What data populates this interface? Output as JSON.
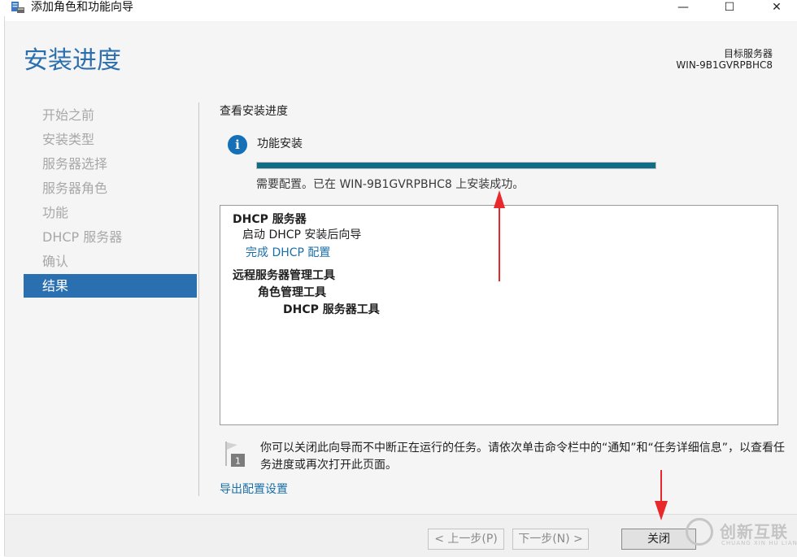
{
  "window": {
    "title": "添加角色和功能向导",
    "minimize_glyph": "—",
    "maximize_glyph": "☐",
    "close_glyph": "✕",
    "icon": "server-wizard-icon"
  },
  "header": {
    "page_title": "安装进度",
    "target_server_label": "目标服务器",
    "target_server_value": "WIN-9B1GVRPBHC8"
  },
  "sidebar": {
    "items": [
      {
        "label": "开始之前",
        "active": false
      },
      {
        "label": "安装类型",
        "active": false
      },
      {
        "label": "服务器选择",
        "active": false
      },
      {
        "label": "服务器角色",
        "active": false
      },
      {
        "label": "功能",
        "active": false
      },
      {
        "label": "DHCP 服务器",
        "active": false
      },
      {
        "label": "确认",
        "active": false
      },
      {
        "label": "结果",
        "active": true
      }
    ]
  },
  "content": {
    "section_title": "查看安装进度",
    "info_icon": "i",
    "feature_label": "功能安装",
    "progress_fraction": 1.0,
    "status_text": "需要配置。已在 WIN-9B1GVRPBHC8 上安装成功。",
    "results": {
      "dhcp_server": "DHCP 服务器",
      "launch_wizard": "启动 DHCP 安装后向导",
      "complete_config_link": "完成 DHCP 配置",
      "rsat": "远程服务器管理工具",
      "role_tools": "角色管理工具",
      "dhcp_tools": "DHCP 服务器工具"
    },
    "notice_badge": "1",
    "notice_text": "你可以关闭此向导而不中断正在运行的任务。请依次单击命令栏中的“通知”和“任务详细信息”，以查看任务进度或再次打开此页面。",
    "export_link": "导出配置设置"
  },
  "footer": {
    "prev_button": "< 上一步(P)",
    "next_button": "下一步(N) >",
    "close_button": "关闭"
  },
  "watermark": {
    "text": "创新互联",
    "sub": "CHUANG XIN HU LIAN"
  },
  "colors": {
    "accent": "#2a6fb0",
    "progress": "#0f6d86",
    "link": "#1a6fa8",
    "annotation_arrow": "#e8282a"
  }
}
